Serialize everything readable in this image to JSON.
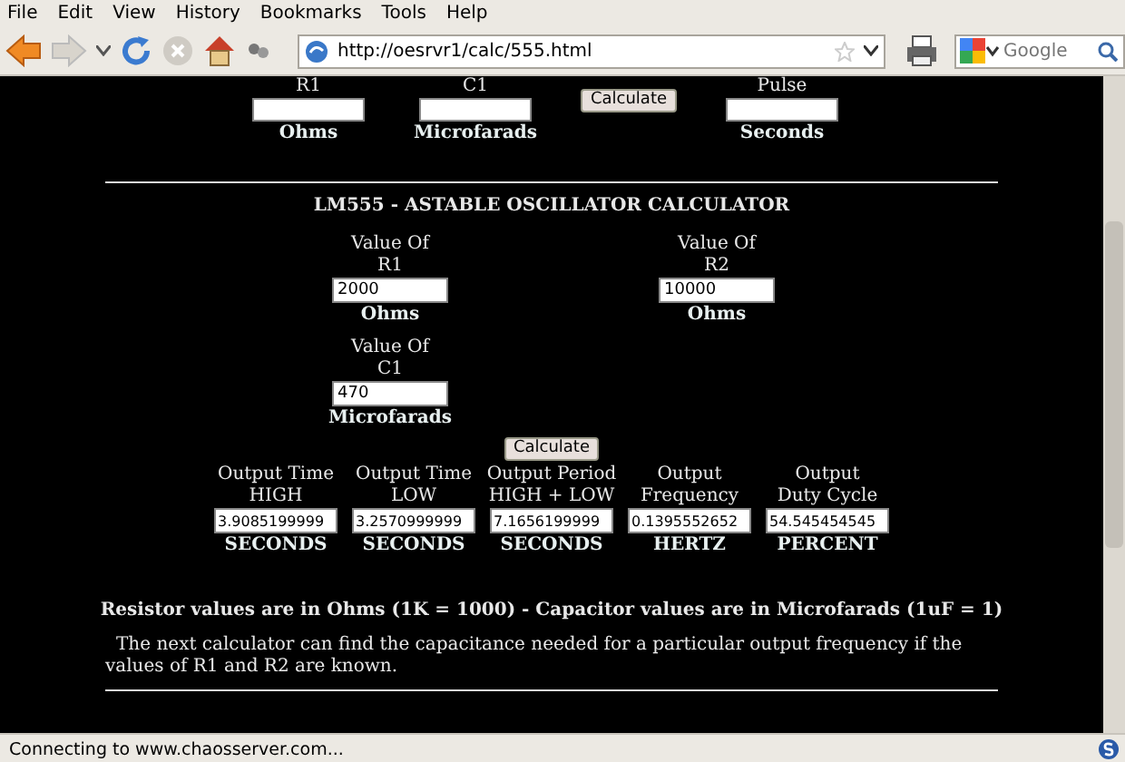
{
  "menu_bar": [
    "File",
    "Edit",
    "View",
    "History",
    "Bookmarks",
    "Tools",
    "Help"
  ],
  "toolbar": {
    "address": "http://oesrvr1/calc/555.html",
    "search": {
      "placeholder": "Google"
    }
  },
  "top_calculator": [
    {
      "kind": "field",
      "label": "R1",
      "unit": "Ohms"
    },
    {
      "kind": "field",
      "label": "C1",
      "unit": "Microfarads"
    },
    {
      "kind": "button",
      "label": "Calculate"
    },
    {
      "kind": "field",
      "label": "Pulse",
      "unit": "Seconds"
    }
  ],
  "astable": {
    "title": "LM555 - ASTABLE OSCILLATOR CALCULATOR",
    "inputs": [
      {
        "label_1": "Value Of",
        "label_2": "R1",
        "value": "2000",
        "unit": "Ohms"
      },
      {
        "label_1": "Value Of",
        "label_2": "R2",
        "value": "10000",
        "unit": "Ohms"
      },
      {
        "label_1": "Value Of",
        "label_2": "C1",
        "value": "470",
        "unit": "Microfarads"
      }
    ],
    "button": "Calculate",
    "outputs": [
      {
        "label_1": "Output Time",
        "label_2": "HIGH",
        "value": "3.9085199999",
        "unit": "SECONDS"
      },
      {
        "label_1": "Output Time",
        "label_2": "LOW",
        "value": "3.2570999999",
        "unit": "SECONDS"
      },
      {
        "label_1": "Output Period",
        "label_2": "HIGH + LOW",
        "value": "7.1656199999",
        "unit": "SECONDS"
      },
      {
        "label_1": "Output",
        "label_2": "Frequency",
        "value": "0.1395552652",
        "unit": "HERTZ"
      },
      {
        "label_1": "Output",
        "label_2": "Duty Cycle",
        "value": "54.545454545",
        "unit": "PERCENT"
      }
    ],
    "note": "Resistor values are in Ohms (1K = 1000) - Capacitor values are in Microfarads (1uF = 1)",
    "paragraph": "The next calculator can find the capacitance needed for a particular output frequency if the values of R1 and R2 are known."
  },
  "status_bar": "Connecting to www.chaosserver.com..."
}
